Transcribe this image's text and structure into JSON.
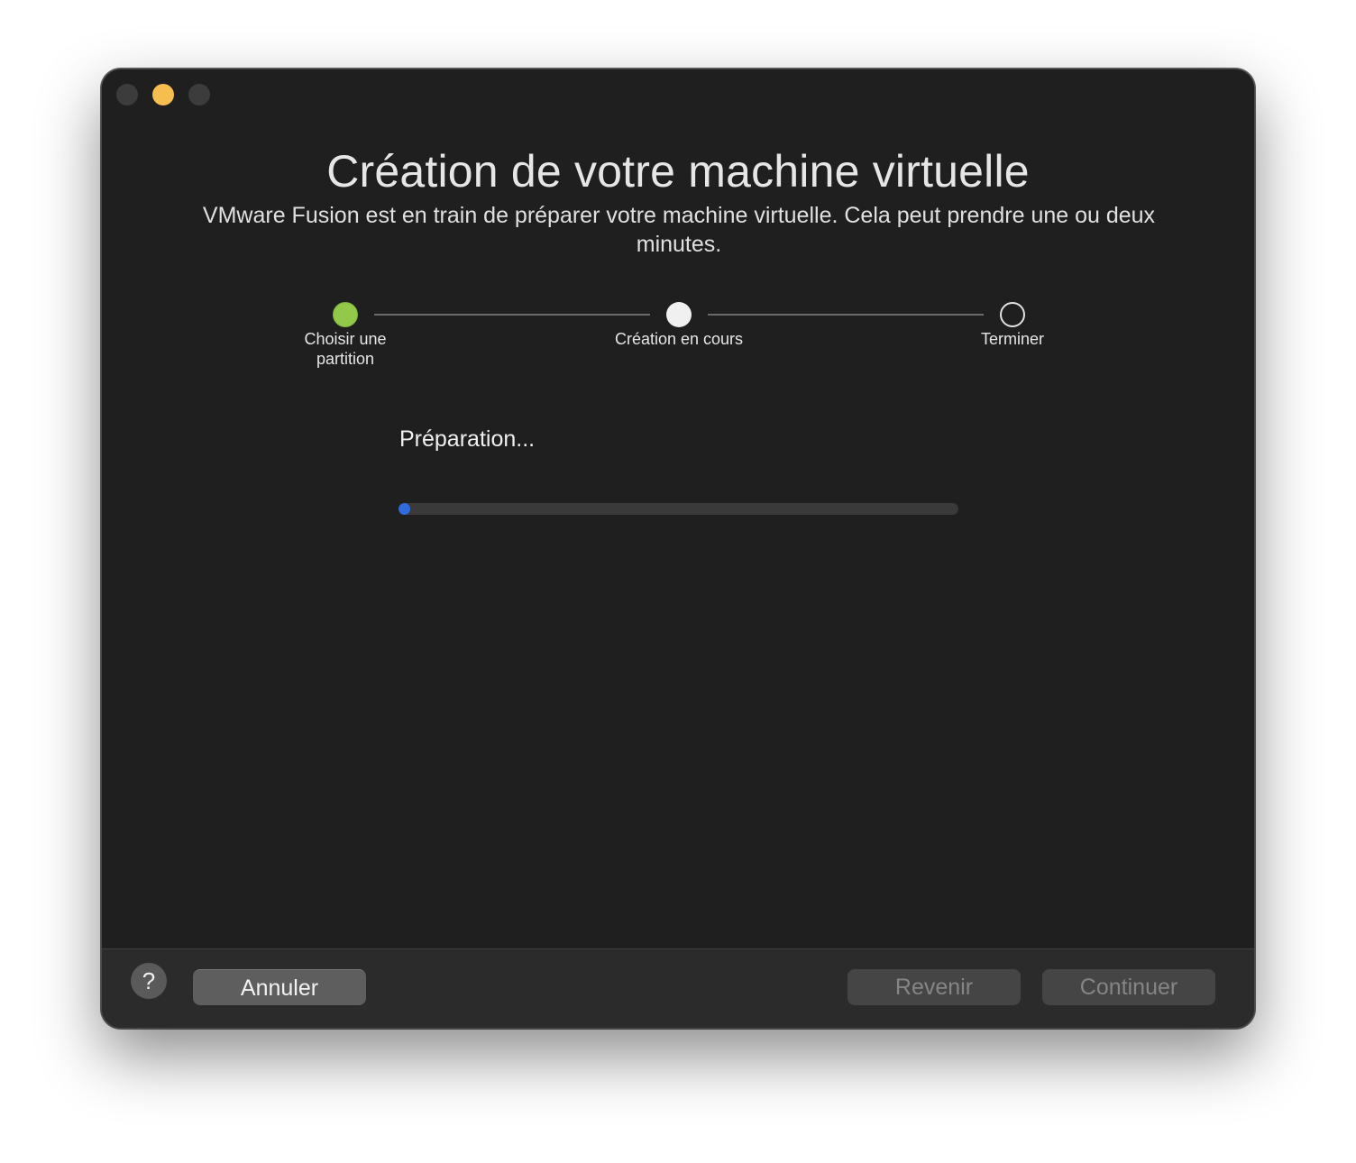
{
  "window": {
    "title": "Création de votre machine virtuelle",
    "subtitle": "VMware Fusion est en train de préparer votre machine virtuelle. Cela peut prendre une ou deux minutes."
  },
  "steps": [
    {
      "label": "Choisir une partition",
      "state": "done"
    },
    {
      "label": "Création en cours",
      "state": "current"
    },
    {
      "label": "Terminer",
      "state": "pending"
    }
  ],
  "progress": {
    "status": "Préparation...",
    "value_percent": 1,
    "color": "#2f6bde"
  },
  "footer": {
    "help_label": "?",
    "cancel_label": "Annuler",
    "back_label": "Revenir",
    "continue_label": "Continuer"
  },
  "colors": {
    "step_done": "#93c94a",
    "minimize_light": "#f6bd4f"
  }
}
